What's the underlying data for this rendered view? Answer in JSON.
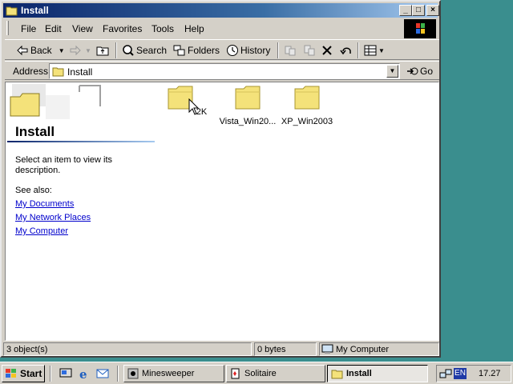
{
  "window": {
    "title": "Install",
    "controls": {
      "minimize": "_",
      "maximize": "□",
      "close": "×"
    }
  },
  "menu": [
    "File",
    "Edit",
    "View",
    "Favorites",
    "Tools",
    "Help"
  ],
  "toolbar": {
    "back": "Back",
    "search": "Search",
    "folders": "Folders",
    "history": "History"
  },
  "address": {
    "label": "Address",
    "value": "Install",
    "go": "Go"
  },
  "left_panel": {
    "title": "Install",
    "description": "Select an item to view its description.",
    "see_also": "See also:",
    "links": [
      "My Documents",
      "My Network Places",
      "My Computer"
    ]
  },
  "files": [
    {
      "name": "2K"
    },
    {
      "name": "Vista_Win20..."
    },
    {
      "name": "XP_Win2003"
    }
  ],
  "status": {
    "objects": "3 object(s)",
    "size": "0 bytes",
    "zone": "My Computer"
  },
  "taskbar": {
    "start": "Start",
    "tasks": [
      {
        "label": "Minesweeper",
        "active": false
      },
      {
        "label": "Solitaire",
        "active": false
      },
      {
        "label": "Install",
        "active": true
      }
    ],
    "tray": {
      "language": "EN",
      "clock": "17.27"
    }
  },
  "colors": {
    "desktop": "#3a8e8e",
    "titlebar_start": "#0a246a",
    "titlebar_end": "#a6caf0",
    "folder": "#f4e27a",
    "link": "#0000cc"
  }
}
